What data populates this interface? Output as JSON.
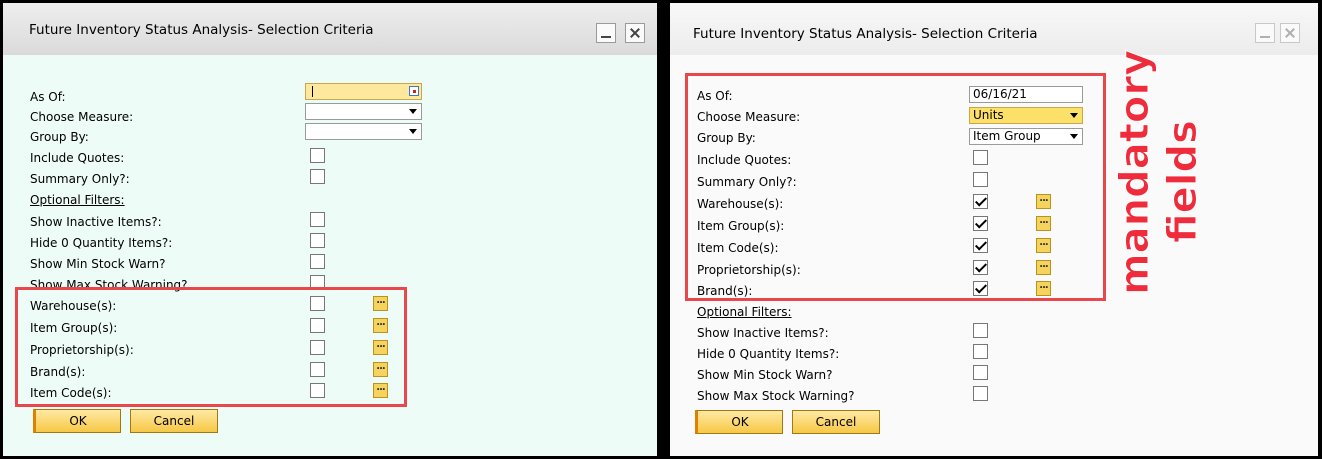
{
  "left": {
    "title": "Future Inventory Status Analysis- Selection Criteria",
    "labels": {
      "as_of": "As Of:",
      "choose_measure": "Choose Measure:",
      "group_by": "Group By:",
      "include_quotes": "Include Quotes:",
      "summary_only": "Summary Only?:",
      "optional_filters": "Optional Filters:",
      "show_inactive": "Show Inactive Items?:",
      "hide_zero": "Hide 0 Quantity Items?:",
      "show_min": "Show Min Stock Warn?",
      "show_max": "Show Max Stock Warning?",
      "warehouse": "Warehouse(s):",
      "item_group": "Item Group(s):",
      "proprietorship": "Proprietorship(s):",
      "brand": "Brand(s):",
      "item_code": "Item Code(s):"
    },
    "values": {
      "as_of": "",
      "choose_measure": "",
      "group_by": ""
    },
    "buttons": {
      "ok": "OK",
      "cancel": "Cancel"
    }
  },
  "right": {
    "title": "Future Inventory Status Analysis- Selection Criteria",
    "labels": {
      "as_of": "As Of:",
      "choose_measure": "Choose Measure:",
      "group_by": "Group By:",
      "include_quotes": "Include Quotes:",
      "summary_only": "Summary Only?:",
      "warehouse": "Warehouse(s):",
      "item_group": "Item Group(s):",
      "item_code": "Item Code(s):",
      "proprietorship": "Proprietorship(s):",
      "brand": "Brand(s):",
      "optional_filters": "Optional Filters:",
      "show_inactive": "Show Inactive Items?:",
      "hide_zero": "Hide 0 Quantity Items?:",
      "show_min": "Show Min Stock Warn?",
      "show_max": "Show Max Stock Warning?"
    },
    "values": {
      "as_of": "06/16/21",
      "choose_measure": "Units",
      "group_by": "Item Group"
    },
    "buttons": {
      "ok": "OK",
      "cancel": "Cancel"
    },
    "annotation": {
      "line1": "mandatory",
      "line2": "fields"
    }
  },
  "colors": {
    "highlight_box": "#e8474c",
    "annotation_text": "#ee2c3b",
    "button_fill": "#f6c846"
  },
  "icons": [
    "minimize-icon",
    "close-icon",
    "calendar-icon",
    "chevron-down-icon",
    "ellipsis-icon"
  ]
}
